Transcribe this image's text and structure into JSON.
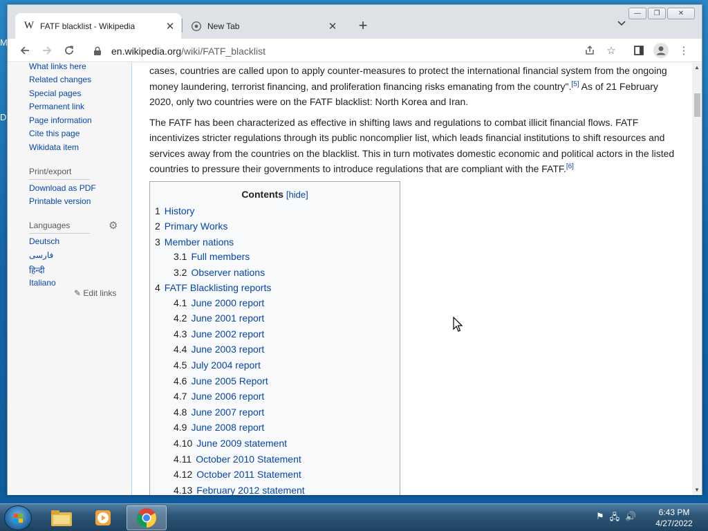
{
  "browser": {
    "tabs": [
      {
        "title": "FATF blacklist - Wikipedia",
        "favicon": "W"
      },
      {
        "title": "New Tab"
      }
    ],
    "url_domain": "en.wikipedia.org",
    "url_path": "/wiki/FATF_blacklist"
  },
  "desktop": {
    "edge_letter_top": "M",
    "edge_letter_mid": "D"
  },
  "sidebar": {
    "tools": [
      "What links here",
      "Related changes",
      "Special pages",
      "Permanent link",
      "Page information",
      "Cite this page",
      "Wikidata item"
    ],
    "print_heading": "Print/export",
    "print_items": [
      "Download as PDF",
      "Printable version"
    ],
    "languages_heading": "Languages",
    "languages": [
      "Deutsch",
      "فارسی",
      "हिन्दी",
      "Italiano"
    ],
    "edit_links": "Edit links"
  },
  "article": {
    "p1_a": "cases, countries are called upon to apply counter-measures to protect the international financial system from the ongoing money laundering, terrorist financing, and proliferation financing risks emanating from the country\".",
    "p1_ref": "[5]",
    "p1_b": " As of 21 February 2020, only two countries were on the FATF blacklist: North Korea and Iran.",
    "p2": "The FATF has been characterized as effective in shifting laws and regulations to combat illicit financial flows. FATF incentivizes stricter regulations through its public noncomplier list, which leads financial institutions to shift resources and services away from the countries on the blacklist. This in turn motivates domestic economic and political actors in the listed countries to pressure their governments to introduce regulations that are compliant with the FATF.",
    "p2_ref": "[6]"
  },
  "toc": {
    "title": "Contents",
    "hide": "[hide]",
    "items": [
      {
        "num": "1",
        "label": "History"
      },
      {
        "num": "2",
        "label": "Primary Works"
      },
      {
        "num": "3",
        "label": "Member nations"
      },
      {
        "num": "3.1",
        "label": "Full members"
      },
      {
        "num": "3.2",
        "label": "Observer nations"
      },
      {
        "num": "4",
        "label": "FATF Blacklisting reports"
      },
      {
        "num": "4.1",
        "label": "June 2000 report"
      },
      {
        "num": "4.2",
        "label": "June 2001 report"
      },
      {
        "num": "4.3",
        "label": "June 2002 report"
      },
      {
        "num": "4.4",
        "label": "June 2003 report"
      },
      {
        "num": "4.5",
        "label": "July 2004 report"
      },
      {
        "num": "4.6",
        "label": "June 2005 Report"
      },
      {
        "num": "4.7",
        "label": "June 2006 report"
      },
      {
        "num": "4.8",
        "label": "June 2007 report"
      },
      {
        "num": "4.9",
        "label": "June 2008 report"
      },
      {
        "num": "4.10",
        "label": "June 2009 statement"
      },
      {
        "num": "4.11",
        "label": "October 2010 Statement"
      },
      {
        "num": "4.12",
        "label": "October 2011 Statement"
      },
      {
        "num": "4.13",
        "label": "February 2012 statement"
      }
    ]
  },
  "taskbar": {
    "time": "6:43 PM",
    "date": "4/27/2022"
  }
}
